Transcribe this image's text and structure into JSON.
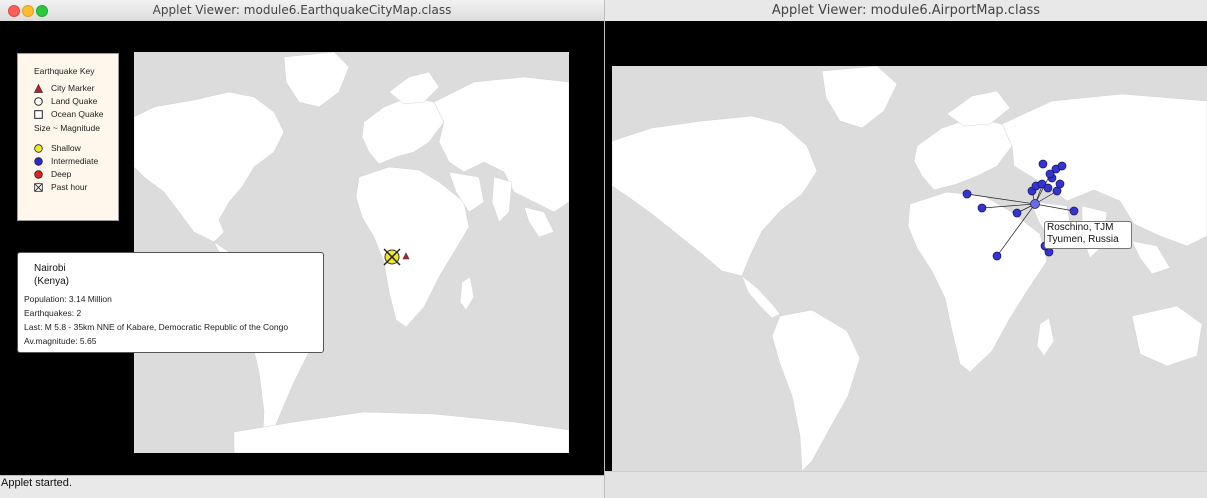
{
  "window1": {
    "title": "Applet Viewer: module6.EarthquakeCityMap.class",
    "status": "Applet started.",
    "key": {
      "title": "Earthquake Key",
      "items": [
        "City Marker",
        "Land Quake",
        "Ocean Quake"
      ],
      "size_label": "Size ~ Magnitude",
      "depth_items": [
        "Shallow",
        "Intermediate",
        "Deep",
        "Past hour"
      ]
    },
    "popup": {
      "name": "Nairobi",
      "country": "(Kenya)",
      "lines": [
        "Population: 3.14 Million",
        "Earthquakes: 2",
        "Last: M 5.8 - 35km NNE of Kabare, Democratic Republic of the Congo",
        "Av.magnitude: 5.65"
      ]
    },
    "colors": {
      "city": "#b8222a",
      "shallow": "#f2e82a",
      "intermediate": "#2a2ad6",
      "deep": "#e02222"
    }
  },
  "window2": {
    "title": "Applet Viewer: module6.AirportMap.class",
    "label": {
      "line1": "Roschino, TJM",
      "line2": "Tyumen, Russia"
    },
    "colors": {
      "airport": "#3434d0"
    }
  },
  "icons": [
    "close-icon",
    "minimize-icon",
    "zoom-icon",
    "triangle-icon",
    "circle-icon",
    "square-icon",
    "past-hour-icon"
  ]
}
